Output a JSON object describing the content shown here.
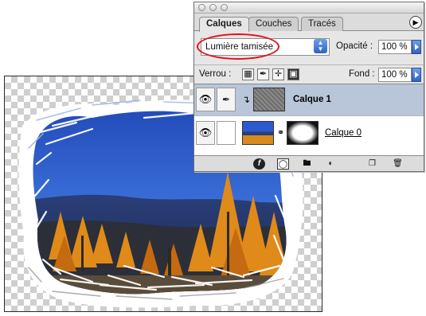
{
  "palette": {
    "tabs": [
      {
        "label": "Calques",
        "active": true
      },
      {
        "label": "Couches",
        "active": false
      },
      {
        "label": "Tracés",
        "active": false
      }
    ],
    "menu_icon": "triangle-right-icon",
    "blend_mode": "Lumière tamisée",
    "opacity_label": "Opacité :",
    "opacity_value": "100 %",
    "lock_label": "Verrou :",
    "fill_label": "Fond :",
    "fill_value": "100 %",
    "layers": [
      {
        "name": "Calque 1",
        "selected": true,
        "clipped": true
      },
      {
        "name": "Calque 0",
        "selected": false,
        "underlined": true
      }
    ],
    "lock_icons": [
      "lock-transparency-icon",
      "lock-brush-icon",
      "lock-move-icon",
      "lock-all-icon"
    ],
    "bottom_icons": [
      "layer-style-icon",
      "mask-icon",
      "folder-icon",
      "adjustment-icon",
      "new-layer-icon",
      "trash-icon"
    ]
  },
  "annotation": {
    "highlight_color": "#e0131a"
  },
  "colors": {
    "selection": "#b9c6d9",
    "accent": "#2f62c5"
  }
}
